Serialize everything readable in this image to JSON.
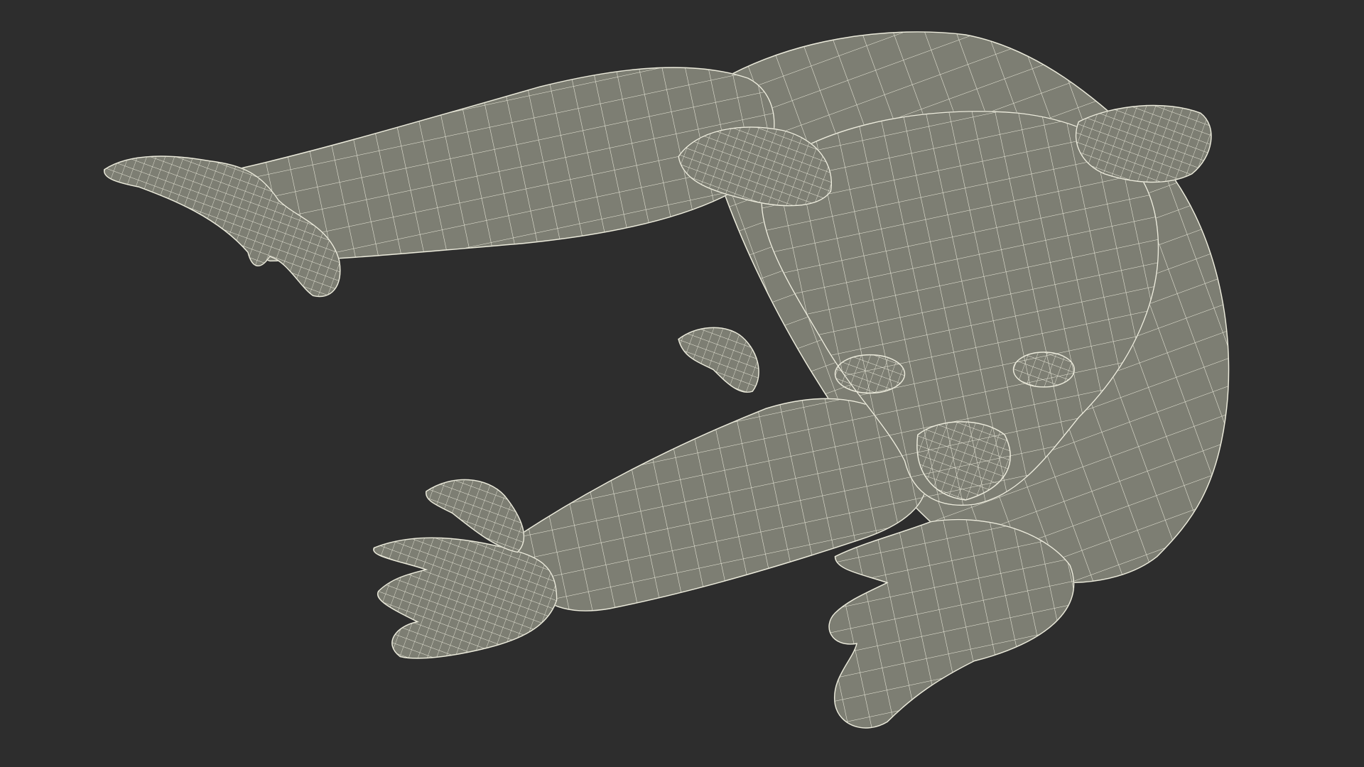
{
  "scene": {
    "subject": "koala-wireframe-model",
    "background_color": "#2d2d2d",
    "surface_color": "#7d7e73",
    "surface_shadow_color": "#5f6058",
    "wire_color": "#ecebdc"
  }
}
